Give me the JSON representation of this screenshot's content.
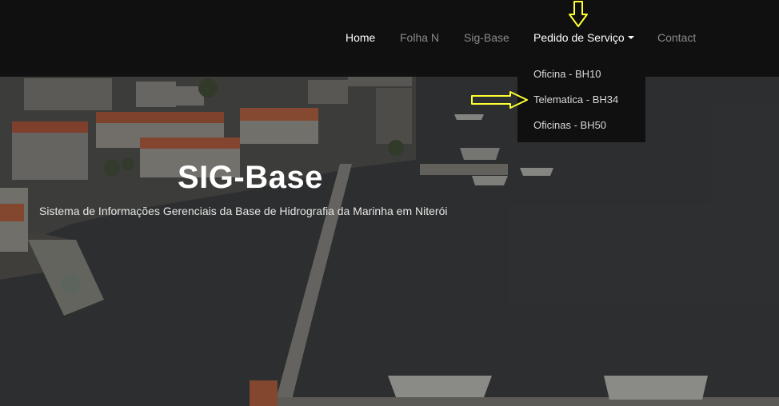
{
  "nav": {
    "items": [
      {
        "label": "Home",
        "state": "active"
      },
      {
        "label": "Folha N",
        "state": "muted"
      },
      {
        "label": "Sig-Base",
        "state": "muted"
      },
      {
        "label": "Pedido de Serviço",
        "state": "open"
      },
      {
        "label": "Contact",
        "state": "muted"
      }
    ]
  },
  "dropdown": {
    "items": [
      {
        "label": "Oficina - BH10"
      },
      {
        "label": "Telematica - BH34"
      },
      {
        "label": "Oficinas - BH50"
      }
    ]
  },
  "hero": {
    "title": "SIG-Base",
    "subtitle": "Sistema de Informações Gerenciais da Base de Hidrografia da Marinha em Niterói"
  },
  "colors": {
    "navbar_bg": "#0e0e0e",
    "nav_active": "#ffffff",
    "nav_muted": "#8a8a8a",
    "annotation": "#ffff33"
  },
  "icons": {
    "annotation_down": "arrow-down-icon",
    "annotation_right": "arrow-right-icon",
    "dropdown_caret": "caret-down-icon"
  }
}
